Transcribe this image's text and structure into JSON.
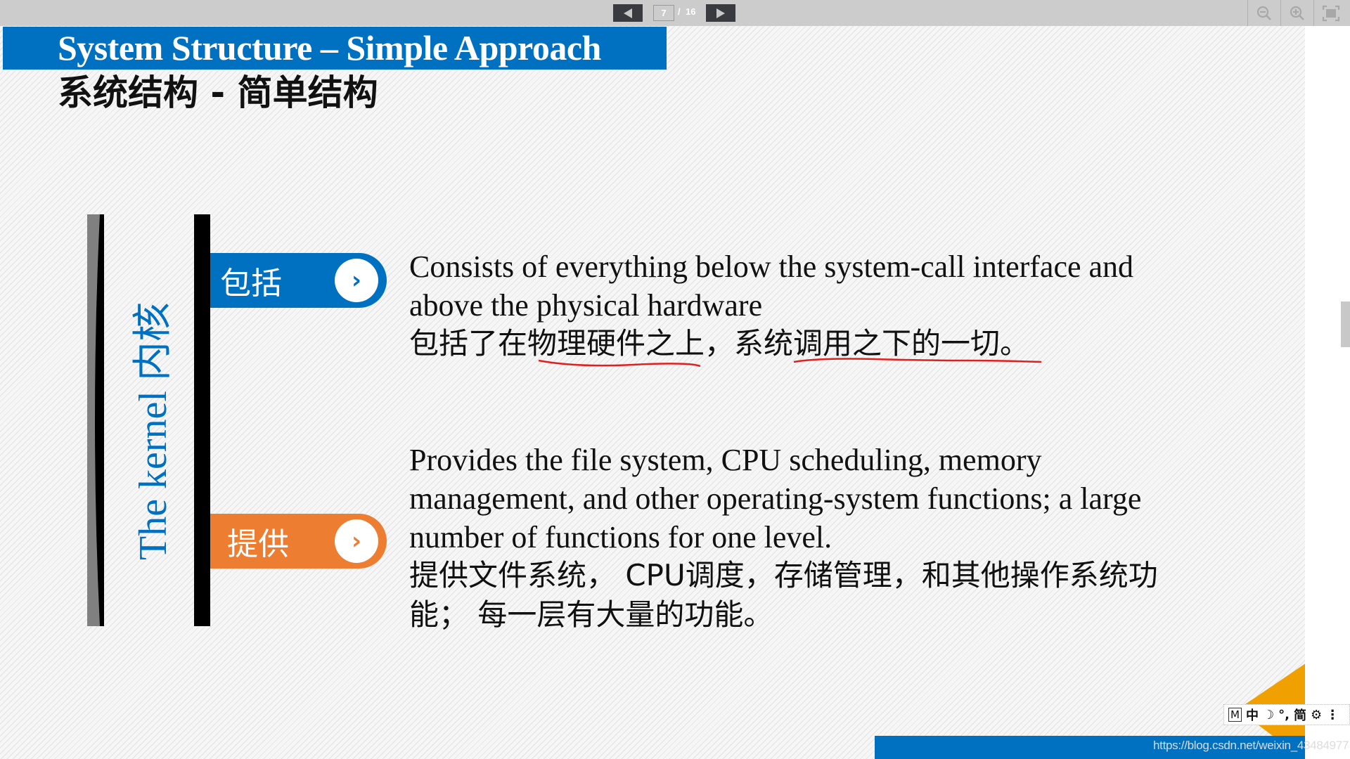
{
  "viewer": {
    "prev_icon": "triangle-left-icon",
    "next_icon": "triangle-right-icon",
    "current_page": "7",
    "page_separator": "/",
    "total_pages": "16",
    "tools": [
      "zoom-out-icon",
      "zoom-in-icon",
      "fullscreen-icon"
    ]
  },
  "slide": {
    "title_en": "System Structure – Simple Approach",
    "title_zh": "系统结构 - 简单结构",
    "vertical_label": "The kernel 内核",
    "items": [
      {
        "label": "包括",
        "arrow": "›",
        "color": "#0070c0",
        "text_en_line1": "Consists of everything below the system-call interface and",
        "text_en_line2": "above the physical hardware",
        "text_zh": "包括了在物理硬件之上，系统调用之下的一切。"
      },
      {
        "label": "提供",
        "arrow": "›",
        "color": "#ed7d31",
        "text_en_line1": "Provides the file system, CPU scheduling, memory",
        "text_en_line2": "management, and other operating-system functions; a large",
        "text_en_line3": "number of functions for one level.",
        "text_zh_line1": "提供文件系统， CPU调度，存储管理，和其他操作系统功",
        "text_zh_line2": "能； 每一层有大量的功能。"
      }
    ],
    "annotation_color": "#e02020",
    "footer_url": "https://blog.csdn.net/weixin_43484977"
  },
  "ime": {
    "mode": "M",
    "lang": "中",
    "moon": "☽",
    "punct": "°,",
    "charset": "简",
    "settings": "⚙",
    "more": "⋮"
  },
  "colors": {
    "brand_blue": "#0070c0",
    "brand_orange": "#ed7d31",
    "corner_gold": "#f0a000"
  }
}
